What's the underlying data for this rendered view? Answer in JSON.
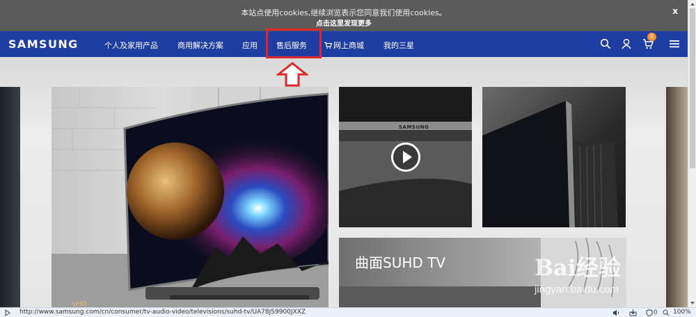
{
  "cookie_bar": {
    "message": "本站点使用cookies,继续浏览表示您同意我们使用cookies。",
    "link": "点击这里发现更多",
    "close": "x"
  },
  "nav": {
    "logo": "SAMSUNG",
    "items": [
      {
        "label": "个人及家用产品"
      },
      {
        "label": "商用解决方案"
      },
      {
        "label": "应用"
      },
      {
        "label": "售后服务"
      },
      {
        "label": "网上商城"
      },
      {
        "label": "我的三星"
      }
    ],
    "cart_count": "0",
    "colors": {
      "nav_bg": "#1f3ea3",
      "highlight": "#e0262b",
      "badge": "#f4902f"
    },
    "icons": [
      "search-icon",
      "user-icon",
      "cart-icon",
      "menu-icon"
    ]
  },
  "content": {
    "video_brand": "SAMSUNG",
    "bottom_card_title": "曲面SUHD TV",
    "main_card_caption": "UHD"
  },
  "status": {
    "url": "http://www.samsung.com/cn/consumer/tv-audio-video/televisions/suhd-tv/UA78JS9900JXXZ",
    "count": "0",
    "zoom": "100%"
  },
  "watermark": {
    "brand": "Bai经验",
    "site": "jingyan.baidu.com"
  }
}
